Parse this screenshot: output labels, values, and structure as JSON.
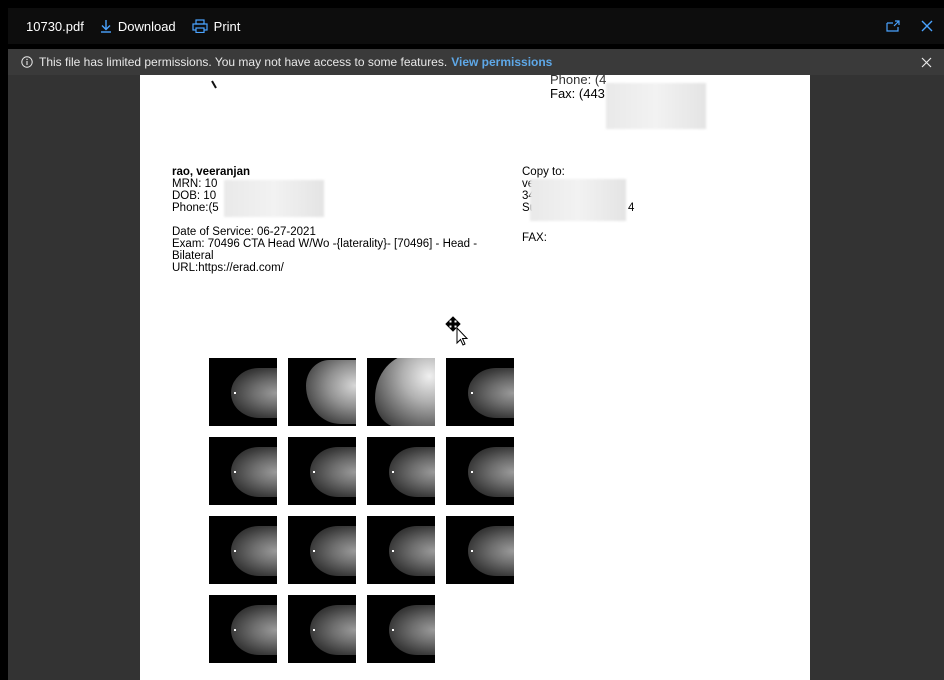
{
  "toolbar": {
    "file_name": "10730.pdf",
    "download_label": "Download",
    "print_label": "Print",
    "download_icon": "download-arrow-icon",
    "print_icon": "printer-icon",
    "popout_icon": "open-in-new-window-icon",
    "close_icon": "close-icon"
  },
  "infobar": {
    "message": "This file has limited permissions. You may not have access to some features.",
    "link_label": "View permissions",
    "info_icon": "info-circle-icon",
    "close_icon": "close-icon"
  },
  "document": {
    "header_phone": "Phone: (4",
    "header_fax": "Fax: (443",
    "patient_name": "rao, veeranjan",
    "mrn": "MRN: 10",
    "dob": "DOB: 10",
    "phone": "Phone:(5",
    "date_of_service": "Date of Service: 06-27-2021",
    "exam_line1": "Exam:  70496 CTA Head W/Wo -{laterality}- [70496] - Head -",
    "exam_line2": "Bilateral",
    "url": "URL:https://erad.com/",
    "copy_to": "Copy to:",
    "copy_line1": "ve",
    "copy_line2": "34",
    "copy_line3": "Su",
    "copy_line3_end": "4",
    "fax_label": "FAX:"
  },
  "thumbnails": {
    "count": 15,
    "columns": 4
  },
  "colors": {
    "toolbar_bg": "#0d0d0d",
    "infobar_bg": "#3a3a3a",
    "viewer_bg": "#333333",
    "link": "#5ea8e8"
  }
}
